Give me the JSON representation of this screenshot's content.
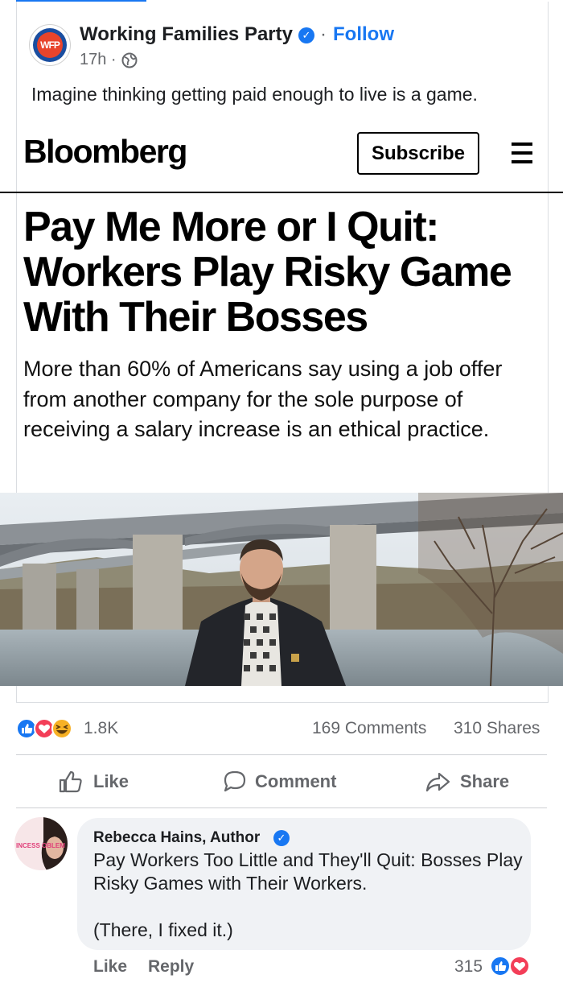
{
  "post": {
    "page_name": "Working Families Party",
    "avatar_text": "WFP",
    "follow_label": "Follow",
    "separator": "·",
    "time": "17h ·",
    "text": "Imagine thinking getting paid enough to live is a game."
  },
  "article": {
    "brand": "Bloomberg",
    "subscribe_label": "Subscribe",
    "headline": "Pay Me More or I Quit: Workers Play Risky Game With Their Bosses",
    "dek": "More than 60% of Americans say using a job offer from another company for the sole purpose of receiving a salary increase is an ethical practice."
  },
  "stats": {
    "reactions": "1.8K",
    "comments": "169 Comments",
    "shares": "310 Shares"
  },
  "actions": {
    "like": "Like",
    "comment": "Comment",
    "share": "Share"
  },
  "comment": {
    "author": "Rebecca Hains, Author",
    "avatar_text": "INCESS OBLEM",
    "text": "Pay Workers Too Little and They'll Quit: Bosses Play Risky Games with Their Workers.",
    "text2": "(There, I fixed it.)",
    "like_label": "Like",
    "reply_label": "Reply",
    "reaction_count": "315"
  },
  "icons": {
    "verified": "verified-badge-icon",
    "globe": "globe-icon",
    "menu": "hamburger-menu-icon",
    "like": "thumbs-up-icon",
    "heart": "heart-icon",
    "haha": "laughing-face-icon",
    "comment": "speech-bubble-icon",
    "share": "share-arrow-icon"
  },
  "colors": {
    "facebook_blue": "#1877f2",
    "heart_red": "#f33e58",
    "haha_yellow": "#f7b125",
    "muted_text": "#65676b",
    "comment_bubble": "#f0f2f5"
  }
}
